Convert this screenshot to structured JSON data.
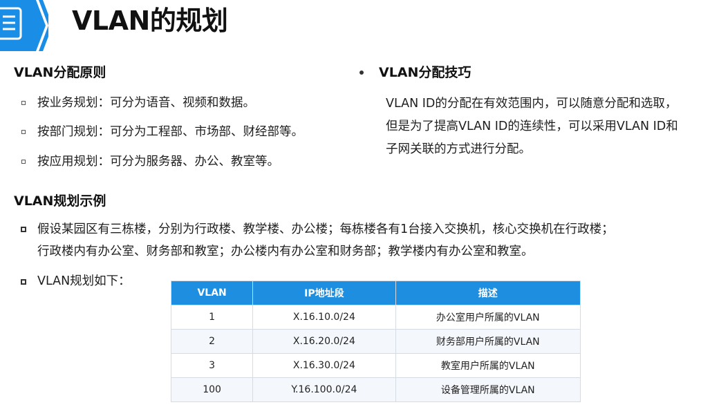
{
  "title": "VLAN的规划",
  "principles": {
    "heading": "VLAN分配原则",
    "items": [
      "按业务规划：可分为语音、视频和数据。",
      "按部门规划：可分为工程部、市场部、财经部等。",
      "按应用规划：可分为服务器、办公、教室等。"
    ]
  },
  "tips": {
    "heading": "VLAN分配技巧",
    "lines": [
      "VLAN ID的分配在有效范围内，可以随意分配和选取，",
      "但是为了提高VLAN ID的连续性，可以采用VLAN ID和",
      "子网关联的方式进行分配。"
    ]
  },
  "example": {
    "heading": "VLAN规划示例",
    "para_lines": [
      "假设某园区有三栋楼，分别为行政楼、教学楼、办公楼；每栋楼各有1台接入交换机，核心交换机在行政楼；",
      "行政楼内有办公室、财务部和教室；办公楼内有办公室和财务部；教学楼内有办公室和教室。"
    ],
    "plan_label": "VLAN规划如下："
  },
  "table": {
    "headers": [
      "VLAN",
      "IP地址段",
      "描述"
    ],
    "rows": [
      [
        "1",
        "X.16.10.0/24",
        "办公室用户所属的VLAN"
      ],
      [
        "2",
        "X.16.20.0/24",
        "财务部用户所属的VLAN"
      ],
      [
        "3",
        "X.16.30.0/24",
        "教室用户所属的VLAN"
      ],
      [
        "100",
        "Y.16.100.0/24",
        "设备管理所属的VLAN"
      ]
    ]
  },
  "colors": {
    "accent": "#1e8fe0",
    "logo_blue": "#1a8ee6"
  },
  "icons": {
    "logo": "document-list-icon"
  }
}
